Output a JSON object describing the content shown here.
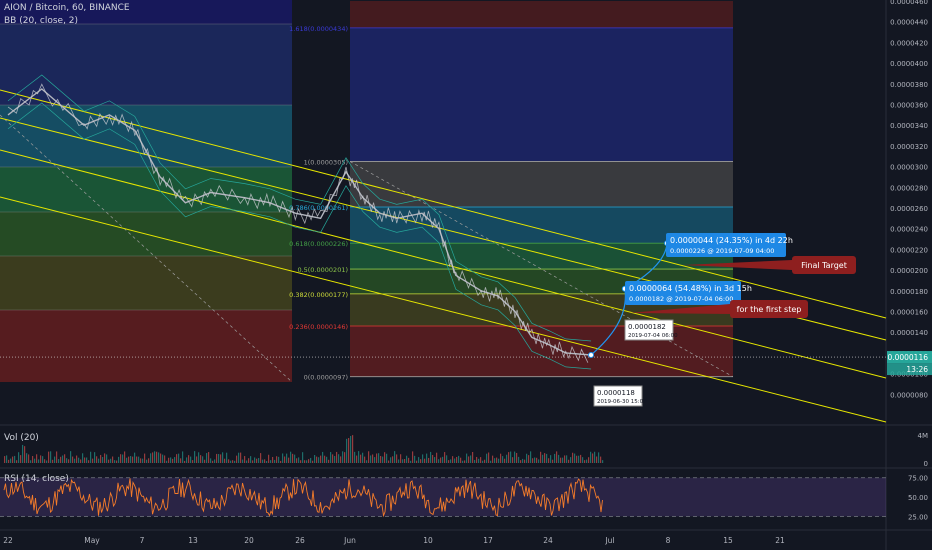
{
  "header": {
    "symbol_line": "AION / Bitcoin, 60, BINANCE",
    "indicator_line": "BB (20, close, 2)"
  },
  "volume_pane": {
    "label": "Vol (20)",
    "ticks": [
      "4M",
      "0"
    ]
  },
  "rsi_pane": {
    "label": "RSI (14, close)",
    "ticks": [
      "75.00",
      "50.00",
      "25.00"
    ]
  },
  "price_axis": {
    "ticks": [
      "0.0000460",
      "0.0000440",
      "0.0000420",
      "0.0000400",
      "0.0000380",
      "0.0000360",
      "0.0000340",
      "0.0000320",
      "0.0000300",
      "0.0000280",
      "0.0000260",
      "0.0000240",
      "0.0000220",
      "0.0000200",
      "0.0000180",
      "0.0000160",
      "0.0000140",
      "0.0000120",
      "0.0000100",
      "0.0000080"
    ],
    "current_price": "0.0000116",
    "countdown": "13:26"
  },
  "time_axis": {
    "ticks": [
      "22",
      "May",
      "7",
      "13",
      "20",
      "26",
      "Jun",
      "10",
      "17",
      "24",
      "Jul",
      "8",
      "15",
      "21"
    ]
  },
  "fib_levels": [
    "1(0.0000305)",
    "0.786(0.0000261)",
    "0.618(0.0000226)",
    "0.5(0.0000201)",
    "0.382(0.0000177)",
    "0.236(0.0000146)",
    "0(0.0000097)",
    "1.618(0.0000434)"
  ],
  "annotations": {
    "box1_line1": "0.0000044 (24.35%) in 4d 22h",
    "box1_line2": "0.0000226 @ 2019-07-09 04:00",
    "box2_line1": "0.0000064 (54.48%) in 3d 15h",
    "box2_line2": "0.0000182 @ 2019-07-04 06:00",
    "label_182_price": "0.0000182",
    "label_182_date": "2019-07-04 06:00",
    "label_118_price": "0.0000118",
    "label_118_date": "2019-06-30 15:00",
    "final_target": "Final Target",
    "first_step": "for the first step"
  },
  "colors": {
    "background": "#131722",
    "channel": "#e6e600",
    "candles": "#b2b5be",
    "rsi": "#f57c2a",
    "callout_blue": "#1e88e5",
    "callout_red": "#8e1f1f"
  },
  "chart_data": {
    "type": "line",
    "title": "AION / Bitcoin, 60, BINANCE",
    "x_range": [
      "Apr 22",
      "Jul 21"
    ],
    "price_series": {
      "name": "AION/BTC",
      "x": [
        "Apr 22",
        "Apr 26",
        "May 1",
        "May 4",
        "May 7",
        "May 10",
        "May 13",
        "May 16",
        "May 20",
        "May 23",
        "May 26",
        "May 29",
        "Jun 1",
        "Jun 3",
        "Jun 5",
        "Jun 7",
        "Jun 10",
        "Jun 12",
        "Jun 14",
        "Jun 17",
        "Jun 19",
        "Jun 21",
        "Jun 23",
        "Jun 25",
        "Jun 27",
        "Jun 30"
      ],
      "values": [
        3.5e-05,
        3.75e-05,
        3.4e-05,
        3.5e-05,
        3.35e-05,
        2.9e-05,
        2.65e-05,
        2.75e-05,
        2.7e-05,
        2.65e-05,
        2.55e-05,
        2.5e-05,
        2.95e-05,
        2.7e-05,
        2.55e-05,
        2.5e-05,
        2.55e-05,
        2.4e-05,
        1.95e-05,
        1.8e-05,
        1.75e-05,
        1.6e-05,
        1.35e-05,
        1.28e-05,
        1.2e-05,
        1.18e-05
      ]
    },
    "projection": {
      "name": "projection",
      "x": [
        "Jun 30",
        "Jul 4",
        "Jul 9"
      ],
      "values": [
        1.18e-05,
        1.82e-05,
        2.26e-05
      ]
    },
    "fibonacci": {
      "levels": [
        1.618,
        1,
        0.786,
        0.618,
        0.5,
        0.382,
        0.236,
        0
      ],
      "prices": [
        4.34e-05,
        3.05e-05,
        2.61e-05,
        2.26e-05,
        2.01e-05,
        1.77e-05,
        1.46e-05,
        9.7e-06
      ]
    },
    "ylim": [
      7.5e-06,
      4.6e-05
    ],
    "rsi": {
      "name": "RSI (14, close)",
      "bands": [
        75,
        50,
        25
      ]
    },
    "volume": {
      "name": "Vol (20)",
      "max_tick": "4M"
    },
    "grid": false
  }
}
